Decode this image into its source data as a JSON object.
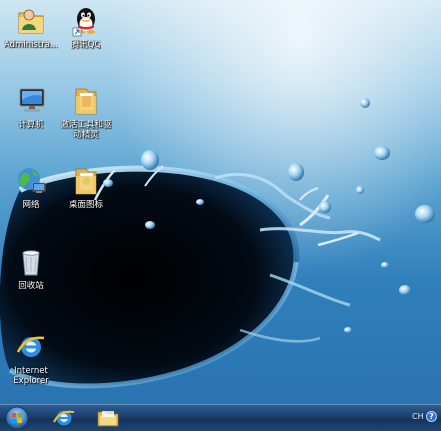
{
  "desktop": {
    "icons": [
      {
        "label": "Administra...",
        "icon": "user-folder-icon"
      },
      {
        "label": "腾讯QQ",
        "icon": "qq-penguin-icon"
      },
      {
        "label": "计算机",
        "icon": "computer-icon"
      },
      {
        "label": "激活工具和驱\n动精灵",
        "icon": "folder-icon"
      },
      {
        "label": "网络",
        "icon": "network-icon"
      },
      {
        "label": "桌面图标",
        "icon": "folder-icon"
      },
      {
        "label": "回收站",
        "icon": "recycle-bin-icon"
      },
      {
        "label": "Internet\nExplorer",
        "icon": "internet-explorer-icon"
      }
    ]
  },
  "taskbar": {
    "start_icon": "windows-start-orb-icon",
    "pinned": [
      {
        "icon": "internet-explorer-icon"
      },
      {
        "icon": "file-explorer-icon"
      }
    ],
    "tray": {
      "language": "CH",
      "help_symbol": "?"
    }
  },
  "colors": {
    "taskbar_dark": "#15335a",
    "water_light": "#cfe6f3",
    "water_dark": "#2a74b0"
  }
}
